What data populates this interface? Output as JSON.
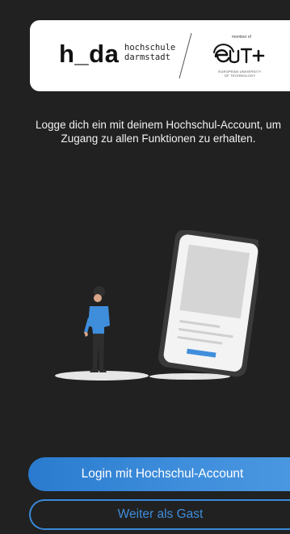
{
  "logo": {
    "hda_mark": "h_da",
    "hda_name_line1": "hochschule",
    "hda_name_line2": "darmstadt",
    "eut_member": "member of",
    "eut_mark": "eut+",
    "eut_sub_line1": "EUROPEAN UNIVERSITY",
    "eut_sub_line2": "OF TECHNOLOGY"
  },
  "intro": {
    "text": "Logge dich ein mit deinem Hochschul-Account, um Zugang zu allen Funktionen zu erhalten."
  },
  "illustration": {
    "icon": "person-with-phone-illustration"
  },
  "actions": {
    "login_label": "Login mit Hochschul-Account",
    "guest_label": "Weiter als Gast"
  },
  "colors": {
    "background": "#212121",
    "accent": "#3f8edc",
    "card": "#ffffff"
  }
}
